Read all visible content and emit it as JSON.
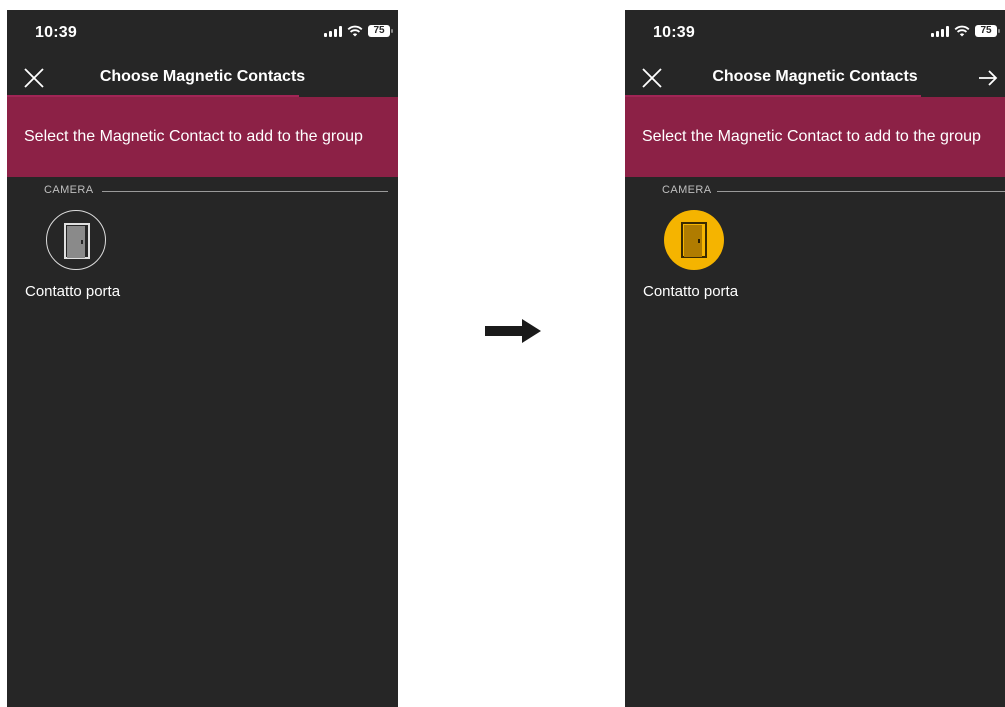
{
  "left_screen": {
    "status": {
      "time": "10:39",
      "battery": "75"
    },
    "nav": {
      "title": "Choose Magnetic Contacts",
      "close_icon": "close-icon"
    },
    "banner": {
      "text": "Select the Magnetic Contact to add to the group",
      "color": "#8c2146"
    },
    "section": {
      "label": "CAMERA"
    },
    "device": {
      "label": "Contatto porta",
      "icon": "door-icon",
      "selected": false
    }
  },
  "right_screen": {
    "status": {
      "time": "10:39",
      "battery": "75"
    },
    "nav": {
      "title": "Choose Magnetic Contacts",
      "close_icon": "close-icon",
      "next_icon": "arrow-right-icon"
    },
    "banner": {
      "text": "Select the Magnetic Contact to add to the group",
      "color": "#8c2146"
    },
    "section": {
      "label": "CAMERA"
    },
    "device": {
      "label": "Contatto porta",
      "icon": "door-icon",
      "selected": true,
      "selected_color": "#f5b400"
    }
  },
  "transition_icon": "arrow-right-icon"
}
